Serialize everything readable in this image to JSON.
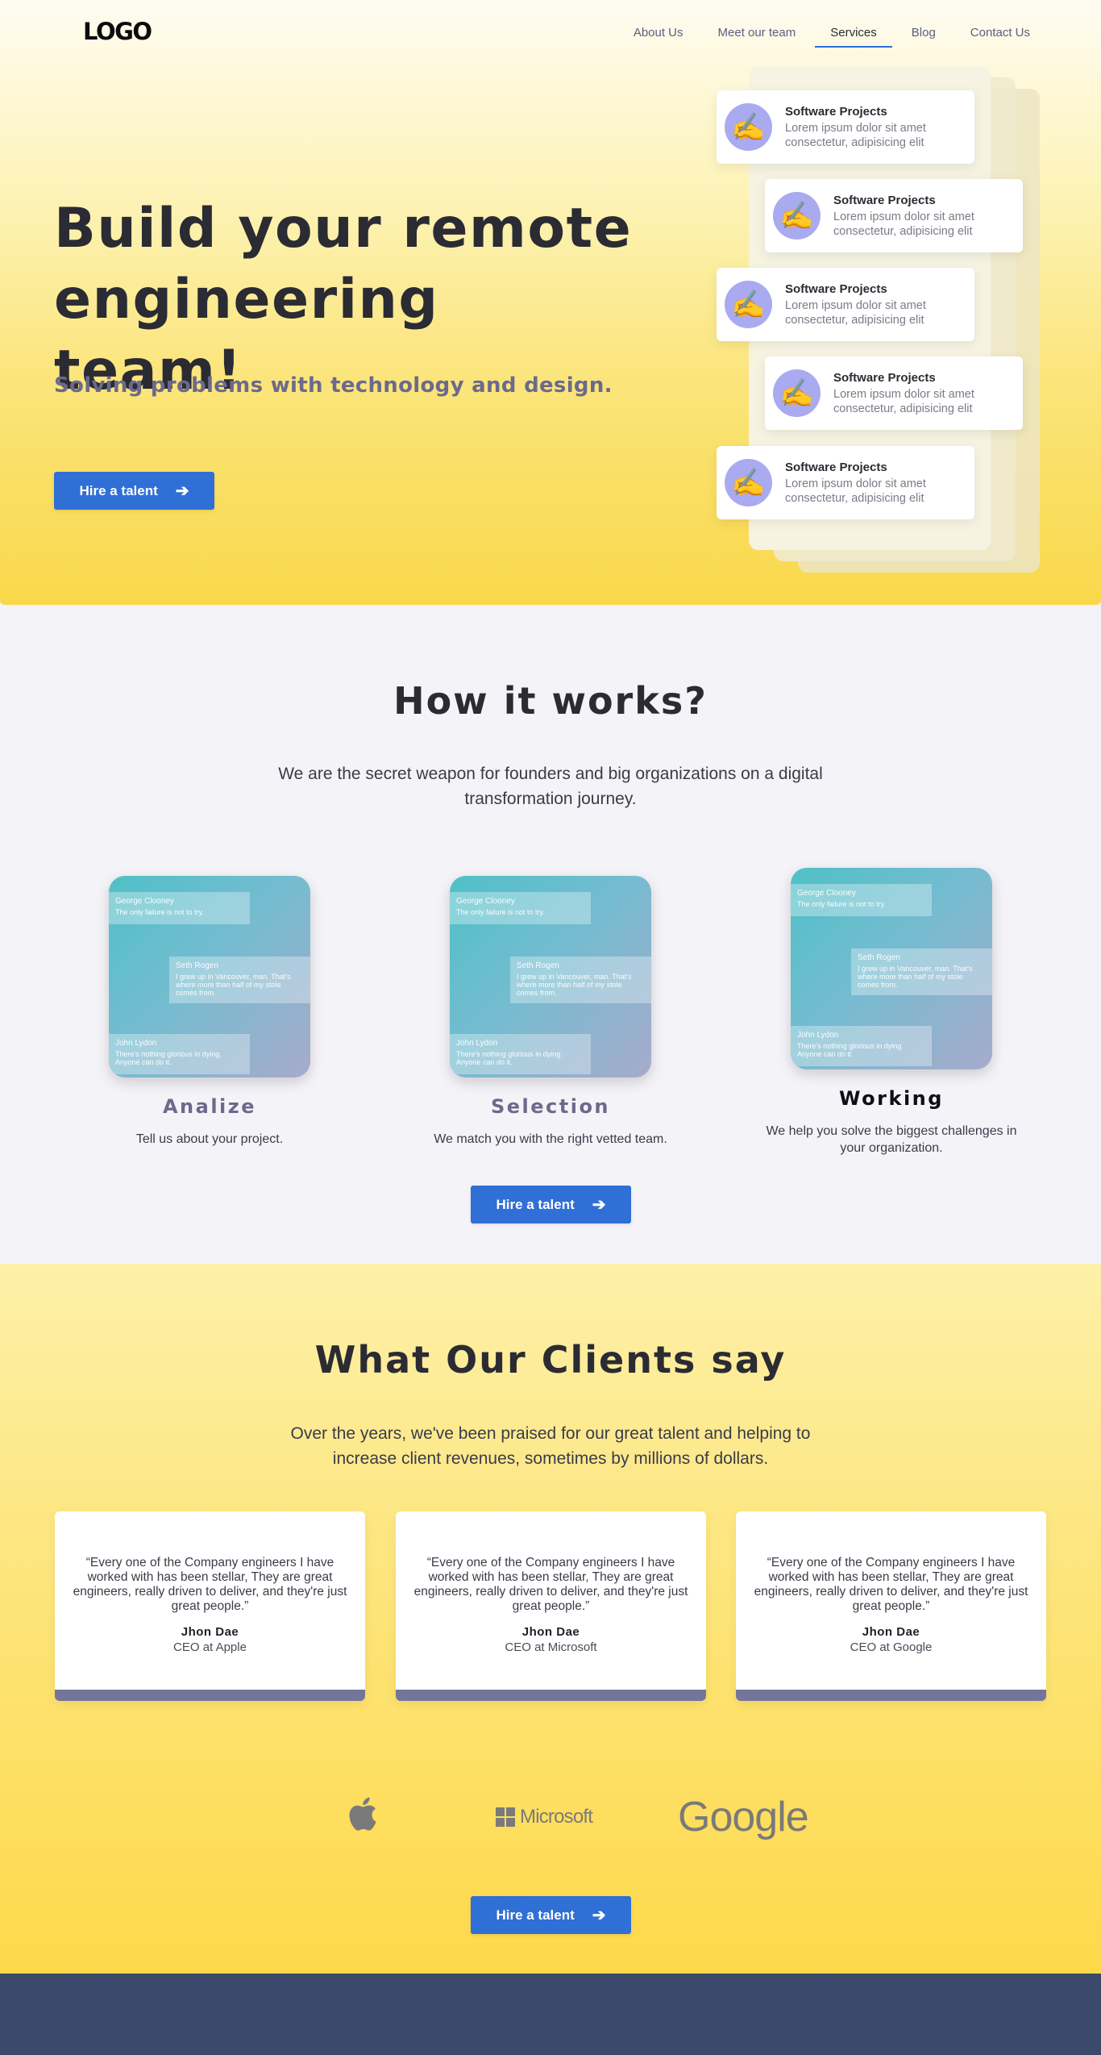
{
  "nav": {
    "logo": "LOGO",
    "links": [
      "About Us",
      "Meet our team",
      "Services",
      "Blog",
      "Contact Us"
    ],
    "active": "Services"
  },
  "hero": {
    "title": "Build your remote engineering team!",
    "subtitle": "Solving problems with technology and design.",
    "cta_label": "Hire a talent",
    "projects": [
      {
        "title": "Software Projects",
        "desc": "Lorem ipsum dolor sit amet consectetur, adipisicing elit"
      },
      {
        "title": "Software Projects",
        "desc": "Lorem ipsum dolor sit amet consectetur, adipisicing elit"
      },
      {
        "title": "Software Projects",
        "desc": "Lorem ipsum dolor sit amet consectetur, adipisicing elit"
      },
      {
        "title": "Software Projects",
        "desc": "Lorem ipsum dolor sit amet consectetur, adipisicing elit"
      },
      {
        "title": "Software Projects",
        "desc": "Lorem ipsum dolor sit amet consectetur, adipisicing elit"
      }
    ]
  },
  "how": {
    "title": "How it works?",
    "desc": "We are the secret weapon for founders and big organizations on a digital transformation journey.",
    "image_bubbles": {
      "b1_name": "George Clooney",
      "b1_text": "The only failure is not to try.",
      "b2_name": "Seth Rogen",
      "b2_text": "I grew up in Vancouver, man. That's where more than half of my stole comes from.",
      "b3_name": "John Lydon",
      "b3_text": "There's nothing glorious in dying. Anyone can do it."
    },
    "steps": [
      {
        "title": "Analize",
        "desc": "Tell us about your project."
      },
      {
        "title": "Selection",
        "desc": "We match you with the right vetted team."
      },
      {
        "title": "Working",
        "desc": "We help you solve the biggest challenges in your organization."
      }
    ],
    "cta_label": "Hire a talent"
  },
  "clients": {
    "title": "What Our Clients say",
    "desc": "Over the years, we've been praised for our great talent and helping to increase client revenues, sometimes by millions of dollars.",
    "testimonials": [
      {
        "quote": "“Every one of the Company engineers I have worked with has been stellar, They are great engineers, really driven to deliver, and they're just great people.”",
        "name": "Jhon Dae",
        "role": "CEO at Apple"
      },
      {
        "quote": "“Every one of the Company engineers I have worked with has been stellar, They are great engineers, really driven to deliver, and they're just great people.”",
        "name": "Jhon Dae",
        "role": "CEO at Microsoft"
      },
      {
        "quote": "“Every one of the Company engineers I have worked with has been stellar, They are great engineers, really driven to deliver, and they're just great people.”",
        "name": "Jhon Dae",
        "role": "CEO at Google"
      }
    ],
    "brands": {
      "microsoft": "Microsoft",
      "google": "Google"
    },
    "cta_label": "Hire a talent"
  },
  "icons": {
    "project": "writing-hand-icon",
    "arrow": "arrow-right-icon",
    "apple": "apple-logo-icon"
  },
  "colors": {
    "accent": "#2f6fd6",
    "avatar": "#a9aaf0",
    "bar": "#75749a",
    "footer": "#3b4a6b"
  }
}
